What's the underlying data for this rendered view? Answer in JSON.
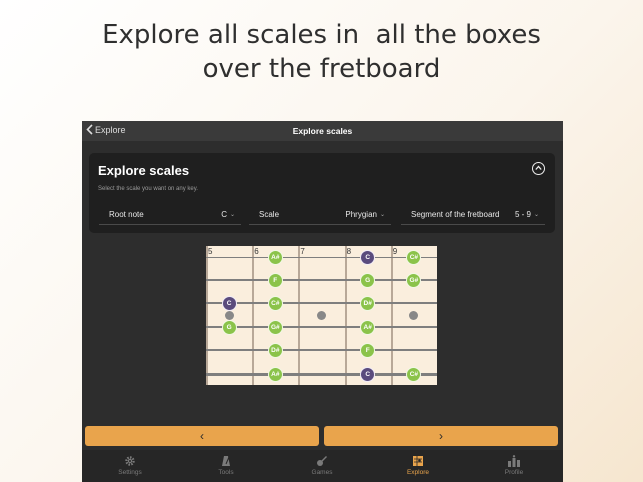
{
  "headline": {
    "line1": "Explore all scales in  all the boxes",
    "line2": "over the fretboard"
  },
  "topbar": {
    "back_label": "Explore",
    "title": "Explore scales"
  },
  "card": {
    "title": "Explore scales",
    "hint": "Select the scale you want on any key.",
    "root": {
      "label": "Root note",
      "value": "C"
    },
    "scale": {
      "label": "Scale",
      "value": "Phrygian"
    },
    "segment": {
      "label": "Segment of the fretboard",
      "value": "5 - 9"
    }
  },
  "fretboard": {
    "fret_numbers": [
      "5",
      "6",
      "7",
      "8",
      "9"
    ],
    "notes": [
      {
        "string": 1,
        "fret": 6,
        "name": "A#",
        "root": false
      },
      {
        "string": 1,
        "fret": 8,
        "name": "C",
        "root": true
      },
      {
        "string": 1,
        "fret": 9,
        "name": "C#",
        "root": false
      },
      {
        "string": 2,
        "fret": 6,
        "name": "F",
        "root": false
      },
      {
        "string": 2,
        "fret": 8,
        "name": "G",
        "root": false
      },
      {
        "string": 2,
        "fret": 9,
        "name": "G#",
        "root": false
      },
      {
        "string": 3,
        "fret": 5,
        "name": "C",
        "root": true
      },
      {
        "string": 3,
        "fret": 6,
        "name": "C#",
        "root": false
      },
      {
        "string": 3,
        "fret": 8,
        "name": "D#",
        "root": false
      },
      {
        "string": 4,
        "fret": 5,
        "name": "G",
        "root": false
      },
      {
        "string": 4,
        "fret": 6,
        "name": "G#",
        "root": false
      },
      {
        "string": 4,
        "fret": 8,
        "name": "A#",
        "root": false
      },
      {
        "string": 5,
        "fret": 6,
        "name": "D#",
        "root": false
      },
      {
        "string": 5,
        "fret": 8,
        "name": "F",
        "root": false
      },
      {
        "string": 6,
        "fret": 6,
        "name": "A#",
        "root": false
      },
      {
        "string": 6,
        "fret": 8,
        "name": "C",
        "root": true
      },
      {
        "string": 6,
        "fret": 9,
        "name": "C#",
        "root": false
      }
    ],
    "inlay_frets": [
      5,
      7,
      9
    ]
  },
  "nav": {
    "prev": "‹",
    "next": "›"
  },
  "tabs": [
    {
      "label": "Settings",
      "icon": "gear-icon",
      "active": false
    },
    {
      "label": "Tools",
      "icon": "metronome-icon",
      "active": false
    },
    {
      "label": "Games",
      "icon": "guitar-icon",
      "active": false
    },
    {
      "label": "Explore",
      "icon": "explore-icon",
      "active": true
    },
    {
      "label": "Profile",
      "icon": "profile-icon",
      "active": false
    }
  ],
  "colors": {
    "accent": "#e9a44c",
    "note_green": "#8bc34a",
    "root_purple": "#5a4b7d",
    "fretboard": "#faeedd"
  }
}
